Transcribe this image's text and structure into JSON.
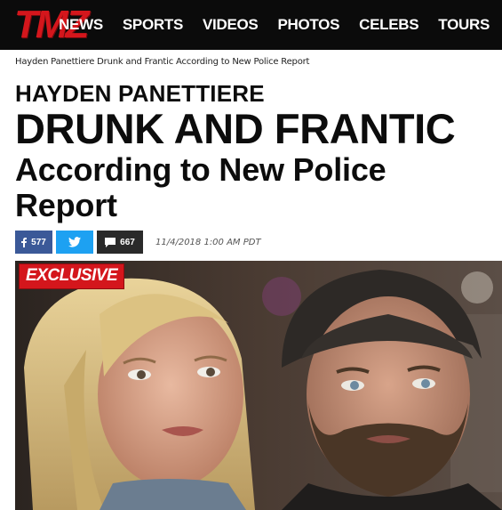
{
  "header": {
    "logo": "TMZ",
    "nav": [
      "NEWS",
      "SPORTS",
      "VIDEOS",
      "PHOTOS",
      "CELEBS",
      "TOURS"
    ]
  },
  "breadcrumb": "Hayden Panettiere Drunk and Frantic According to New Police Report",
  "article": {
    "title_name": "HAYDEN PANETTIERE",
    "title_main": "DRUNK AND FRANTIC",
    "title_sub": "According to New Police Report",
    "timestamp": "11/4/2018 1:00 AM PDT"
  },
  "share": {
    "facebook_count": "577",
    "comments_count": "667"
  },
  "photo": {
    "badge": "EXCLUSIVE"
  },
  "colors": {
    "brand_red": "#d4161c",
    "facebook_blue": "#3b5998",
    "twitter_blue": "#1da1f2"
  }
}
